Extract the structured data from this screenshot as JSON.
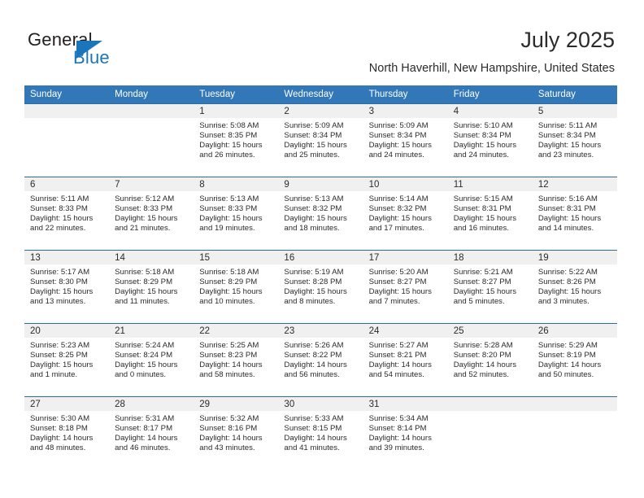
{
  "brand": {
    "name_part1": "General",
    "name_part2": "Blue"
  },
  "header": {
    "title": "July 2025",
    "location": "North Haverhill, New Hampshire, United States"
  },
  "colors": {
    "header_blue": "#3277b8",
    "border_blue": "#2e6da4",
    "daynum_bg": "#f0f0f0",
    "brand_blue": "#1b75bb",
    "text": "#2b2b2b"
  },
  "weekdays": [
    "Sunday",
    "Monday",
    "Tuesday",
    "Wednesday",
    "Thursday",
    "Friday",
    "Saturday"
  ],
  "labels": {
    "sunrise": "Sunrise:",
    "sunset": "Sunset:",
    "daylight": "Daylight:"
  },
  "weeks": [
    [
      {
        "day": "",
        "sunrise": "",
        "sunset": "",
        "daylight": ""
      },
      {
        "day": "",
        "sunrise": "",
        "sunset": "",
        "daylight": ""
      },
      {
        "day": "1",
        "sunrise": "Sunrise: 5:08 AM",
        "sunset": "Sunset: 8:35 PM",
        "daylight": "Daylight: 15 hours and 26 minutes."
      },
      {
        "day": "2",
        "sunrise": "Sunrise: 5:09 AM",
        "sunset": "Sunset: 8:34 PM",
        "daylight": "Daylight: 15 hours and 25 minutes."
      },
      {
        "day": "3",
        "sunrise": "Sunrise: 5:09 AM",
        "sunset": "Sunset: 8:34 PM",
        "daylight": "Daylight: 15 hours and 24 minutes."
      },
      {
        "day": "4",
        "sunrise": "Sunrise: 5:10 AM",
        "sunset": "Sunset: 8:34 PM",
        "daylight": "Daylight: 15 hours and 24 minutes."
      },
      {
        "day": "5",
        "sunrise": "Sunrise: 5:11 AM",
        "sunset": "Sunset: 8:34 PM",
        "daylight": "Daylight: 15 hours and 23 minutes."
      }
    ],
    [
      {
        "day": "6",
        "sunrise": "Sunrise: 5:11 AM",
        "sunset": "Sunset: 8:33 PM",
        "daylight": "Daylight: 15 hours and 22 minutes."
      },
      {
        "day": "7",
        "sunrise": "Sunrise: 5:12 AM",
        "sunset": "Sunset: 8:33 PM",
        "daylight": "Daylight: 15 hours and 21 minutes."
      },
      {
        "day": "8",
        "sunrise": "Sunrise: 5:13 AM",
        "sunset": "Sunset: 8:33 PM",
        "daylight": "Daylight: 15 hours and 19 minutes."
      },
      {
        "day": "9",
        "sunrise": "Sunrise: 5:13 AM",
        "sunset": "Sunset: 8:32 PM",
        "daylight": "Daylight: 15 hours and 18 minutes."
      },
      {
        "day": "10",
        "sunrise": "Sunrise: 5:14 AM",
        "sunset": "Sunset: 8:32 PM",
        "daylight": "Daylight: 15 hours and 17 minutes."
      },
      {
        "day": "11",
        "sunrise": "Sunrise: 5:15 AM",
        "sunset": "Sunset: 8:31 PM",
        "daylight": "Daylight: 15 hours and 16 minutes."
      },
      {
        "day": "12",
        "sunrise": "Sunrise: 5:16 AM",
        "sunset": "Sunset: 8:31 PM",
        "daylight": "Daylight: 15 hours and 14 minutes."
      }
    ],
    [
      {
        "day": "13",
        "sunrise": "Sunrise: 5:17 AM",
        "sunset": "Sunset: 8:30 PM",
        "daylight": "Daylight: 15 hours and 13 minutes."
      },
      {
        "day": "14",
        "sunrise": "Sunrise: 5:18 AM",
        "sunset": "Sunset: 8:29 PM",
        "daylight": "Daylight: 15 hours and 11 minutes."
      },
      {
        "day": "15",
        "sunrise": "Sunrise: 5:18 AM",
        "sunset": "Sunset: 8:29 PM",
        "daylight": "Daylight: 15 hours and 10 minutes."
      },
      {
        "day": "16",
        "sunrise": "Sunrise: 5:19 AM",
        "sunset": "Sunset: 8:28 PM",
        "daylight": "Daylight: 15 hours and 8 minutes."
      },
      {
        "day": "17",
        "sunrise": "Sunrise: 5:20 AM",
        "sunset": "Sunset: 8:27 PM",
        "daylight": "Daylight: 15 hours and 7 minutes."
      },
      {
        "day": "18",
        "sunrise": "Sunrise: 5:21 AM",
        "sunset": "Sunset: 8:27 PM",
        "daylight": "Daylight: 15 hours and 5 minutes."
      },
      {
        "day": "19",
        "sunrise": "Sunrise: 5:22 AM",
        "sunset": "Sunset: 8:26 PM",
        "daylight": "Daylight: 15 hours and 3 minutes."
      }
    ],
    [
      {
        "day": "20",
        "sunrise": "Sunrise: 5:23 AM",
        "sunset": "Sunset: 8:25 PM",
        "daylight": "Daylight: 15 hours and 1 minute."
      },
      {
        "day": "21",
        "sunrise": "Sunrise: 5:24 AM",
        "sunset": "Sunset: 8:24 PM",
        "daylight": "Daylight: 15 hours and 0 minutes."
      },
      {
        "day": "22",
        "sunrise": "Sunrise: 5:25 AM",
        "sunset": "Sunset: 8:23 PM",
        "daylight": "Daylight: 14 hours and 58 minutes."
      },
      {
        "day": "23",
        "sunrise": "Sunrise: 5:26 AM",
        "sunset": "Sunset: 8:22 PM",
        "daylight": "Daylight: 14 hours and 56 minutes."
      },
      {
        "day": "24",
        "sunrise": "Sunrise: 5:27 AM",
        "sunset": "Sunset: 8:21 PM",
        "daylight": "Daylight: 14 hours and 54 minutes."
      },
      {
        "day": "25",
        "sunrise": "Sunrise: 5:28 AM",
        "sunset": "Sunset: 8:20 PM",
        "daylight": "Daylight: 14 hours and 52 minutes."
      },
      {
        "day": "26",
        "sunrise": "Sunrise: 5:29 AM",
        "sunset": "Sunset: 8:19 PM",
        "daylight": "Daylight: 14 hours and 50 minutes."
      }
    ],
    [
      {
        "day": "27",
        "sunrise": "Sunrise: 5:30 AM",
        "sunset": "Sunset: 8:18 PM",
        "daylight": "Daylight: 14 hours and 48 minutes."
      },
      {
        "day": "28",
        "sunrise": "Sunrise: 5:31 AM",
        "sunset": "Sunset: 8:17 PM",
        "daylight": "Daylight: 14 hours and 46 minutes."
      },
      {
        "day": "29",
        "sunrise": "Sunrise: 5:32 AM",
        "sunset": "Sunset: 8:16 PM",
        "daylight": "Daylight: 14 hours and 43 minutes."
      },
      {
        "day": "30",
        "sunrise": "Sunrise: 5:33 AM",
        "sunset": "Sunset: 8:15 PM",
        "daylight": "Daylight: 14 hours and 41 minutes."
      },
      {
        "day": "31",
        "sunrise": "Sunrise: 5:34 AM",
        "sunset": "Sunset: 8:14 PM",
        "daylight": "Daylight: 14 hours and 39 minutes."
      },
      {
        "day": "",
        "sunrise": "",
        "sunset": "",
        "daylight": ""
      },
      {
        "day": "",
        "sunrise": "",
        "sunset": "",
        "daylight": ""
      }
    ]
  ]
}
